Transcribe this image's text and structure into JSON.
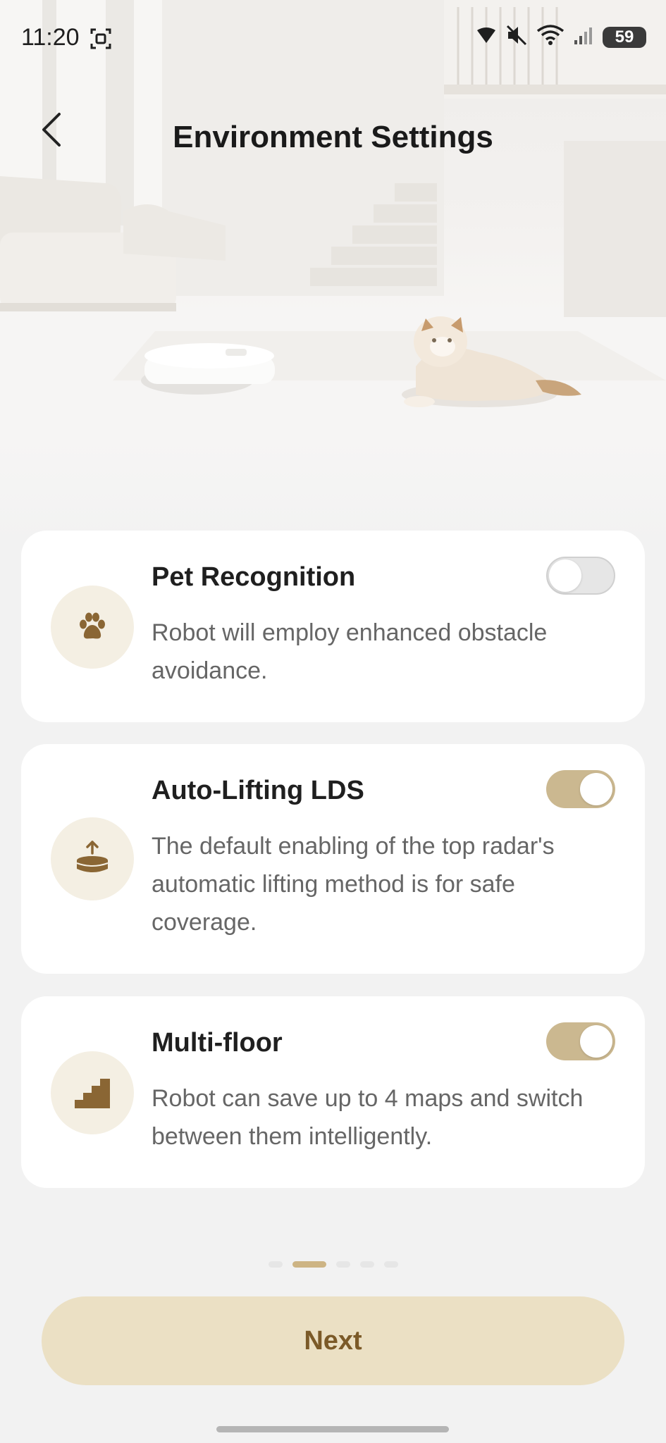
{
  "status_bar": {
    "time": "11:20",
    "battery": "59"
  },
  "header": {
    "title": "Environment Settings"
  },
  "cards": [
    {
      "title": "Pet Recognition",
      "description": "Robot will employ enhanced obstacle avoidance.",
      "icon": "paw-icon",
      "enabled": false
    },
    {
      "title": "Auto-Lifting LDS",
      "description": "The default enabling of the top radar's automatic lifting method is for safe coverage.",
      "icon": "lift-radar-icon",
      "enabled": true
    },
    {
      "title": "Multi-floor",
      "description": "Robot can save up to 4 maps and switch between them intelligently.",
      "icon": "stairs-icon",
      "enabled": true
    }
  ],
  "pagination": {
    "total": 5,
    "current": 2
  },
  "footer": {
    "next_label": "Next"
  },
  "colors": {
    "accent": "#cbb890",
    "button_bg": "#ebe0c4",
    "button_text": "#7b5a28",
    "icon_brown": "#8a6634"
  }
}
